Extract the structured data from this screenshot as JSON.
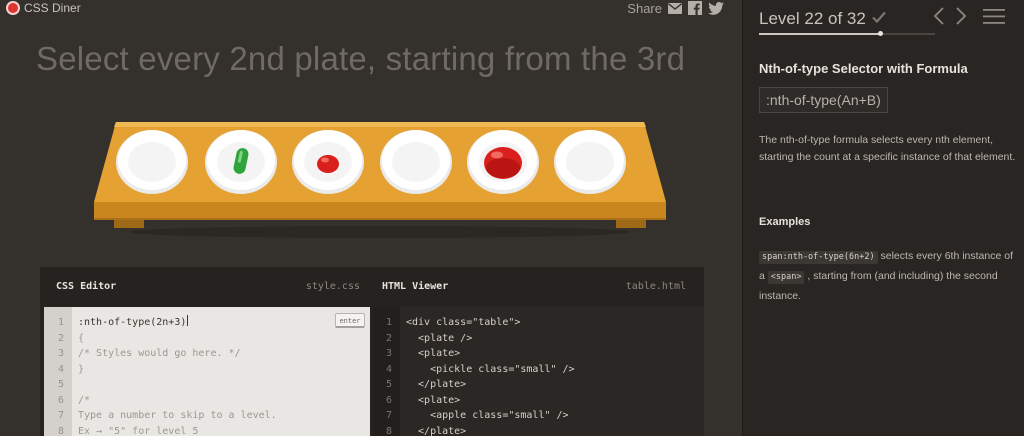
{
  "app": {
    "logo_text": "CSS Diner"
  },
  "share": {
    "label": "Share",
    "icons": [
      "mail-icon",
      "facebook-icon",
      "twitter-icon"
    ]
  },
  "instruction": "Select every 2nd plate, starting from the 3rd",
  "table": {
    "items": [
      {
        "element": "plate",
        "contents": "none"
      },
      {
        "element": "plate",
        "contents": "pickle small"
      },
      {
        "element": "plate",
        "contents": "apple small"
      },
      {
        "element": "plate",
        "contents": "none"
      },
      {
        "element": "plate",
        "contents": "apple"
      },
      {
        "element": "plate",
        "contents": "none"
      }
    ]
  },
  "editor": {
    "css_title": "CSS Editor",
    "css_file": "style.css",
    "enter_label": "enter",
    "css_input": ":nth-of-type(2n+3)",
    "css_lines": [
      {
        "n": "1",
        "text": ":nth-of-type(2n+3)"
      },
      {
        "n": "2",
        "text": "{"
      },
      {
        "n": "3",
        "text": "/* Styles would go here. */"
      },
      {
        "n": "4",
        "text": "}"
      },
      {
        "n": "5",
        "text": ""
      },
      {
        "n": "6",
        "text": "/*"
      },
      {
        "n": "7",
        "text": "Type a number to skip to a level."
      },
      {
        "n": "8",
        "text": "Ex → \"5\" for level 5"
      }
    ],
    "html_title": "HTML Viewer",
    "html_file": "table.html",
    "html_lines": [
      {
        "n": "1",
        "text": "<div class=\"table\">"
      },
      {
        "n": "2",
        "text": "  <plate />"
      },
      {
        "n": "3",
        "text": "  <plate>"
      },
      {
        "n": "4",
        "text": "    <pickle class=\"small\" />"
      },
      {
        "n": "5",
        "text": "  </plate>"
      },
      {
        "n": "6",
        "text": "  <plate>"
      },
      {
        "n": "7",
        "text": "    <apple class=\"small\" />"
      },
      {
        "n": "8",
        "text": "  </plate>"
      }
    ]
  },
  "sidebar": {
    "level_text": "Level 22 of 32",
    "level_current": 22,
    "level_total": 32,
    "selector_name": "Nth-of-type Selector with Formula",
    "syntax": ":nth-of-type(An+B)",
    "hint": "The nth-of-type formula selects every nth element, starting the count at a specific instance of that element.",
    "examples_title": "Examples",
    "example": {
      "code1": "span:nth-of-type(6n+2)",
      "text1": " selects every 6th instance of a ",
      "code2": "<span>",
      "text2": " , starting from (and including) the second instance."
    }
  },
  "colors": {
    "table": "#e09c2c",
    "plate": "#ffffff",
    "apple": "#d9201d",
    "pickle": "#2ea43a",
    "logo": "#e0322e"
  }
}
